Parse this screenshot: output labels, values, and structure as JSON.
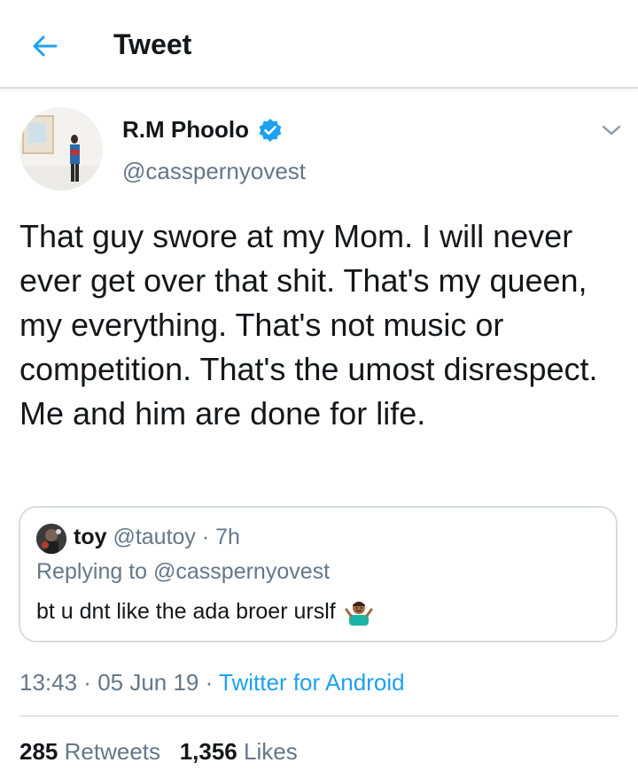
{
  "header": {
    "title": "Tweet",
    "back_icon": "arrow-left-icon"
  },
  "tweet": {
    "author_name": "R.M Phoolo",
    "author_handle": "@casspernyovest",
    "verified": true,
    "text": "That guy swore at my Mom. I will never ever get over that shit. That's my queen, my everything. That's not music or competition. That's the umost disrespect. Me and him are done for life.",
    "time": "13:43",
    "separator": " · ",
    "date": "05 Jun 19",
    "source": "Twitter for Android"
  },
  "quoted_tweet": {
    "name": "toy",
    "handle": "@tautoy",
    "separator": " · ",
    "age": "7h",
    "reply_to": "Replying to @casspernyovest",
    "text": "bt u dnt like the ada broer urslf",
    "emoji": "person-shrugging"
  },
  "stats": {
    "retweets_count": "285",
    "retweets_label": "Retweets",
    "likes_count": "1,356",
    "likes_label": "Likes"
  },
  "colors": {
    "accent": "#1da1f2",
    "secondary_text": "#657786",
    "primary_text": "#14171a",
    "border": "#e1e8ed"
  }
}
